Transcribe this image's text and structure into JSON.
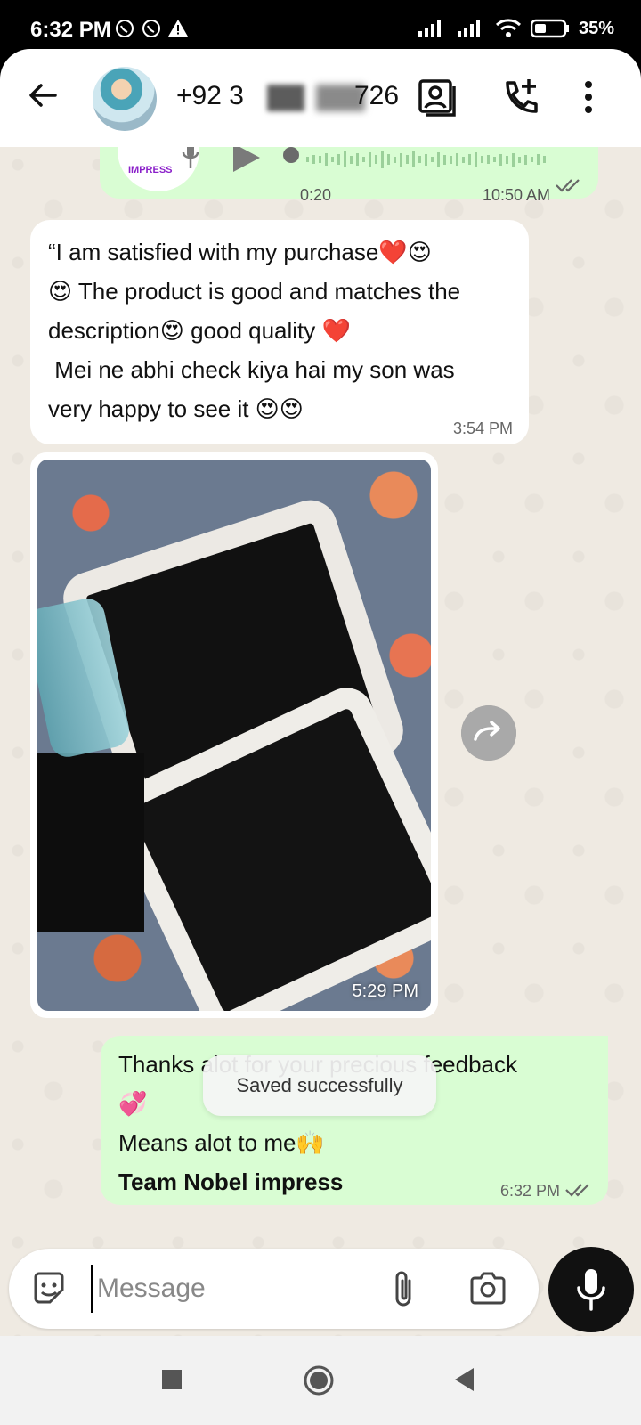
{
  "status_bar": {
    "time": "6:32 PM",
    "battery": "35%"
  },
  "header": {
    "contact_prefix": "+92 3",
    "contact_suffix": "726"
  },
  "messages": {
    "voice": {
      "brand": "IMPRESS",
      "duration": "0:20",
      "time": "10:50 AM"
    },
    "review": {
      "line1": "“I am satisfied with my purchase❤️😍",
      "line2": "😍 The product is good and matches the",
      "line3": "description😍 good quality ❤️",
      "line4": " Mei ne abhi check kiya hai my son was",
      "line5": "very happy to see it 😍😍",
      "time": "3:54 PM"
    },
    "photo": {
      "time": "5:29 PM"
    },
    "reply": {
      "line1": "Thanks alot for your precious feedback",
      "line2": "💞",
      "line3": "Means alot to me🙌",
      "line4": "Team Nobel impress",
      "time": "6:32 PM"
    }
  },
  "toast": "Saved successfully",
  "composer": {
    "placeholder": "Message"
  },
  "colors": {
    "outgoing_bubble": "#d9fdd3",
    "incoming_bubble": "#ffffff",
    "chat_background": "#efeae2"
  }
}
